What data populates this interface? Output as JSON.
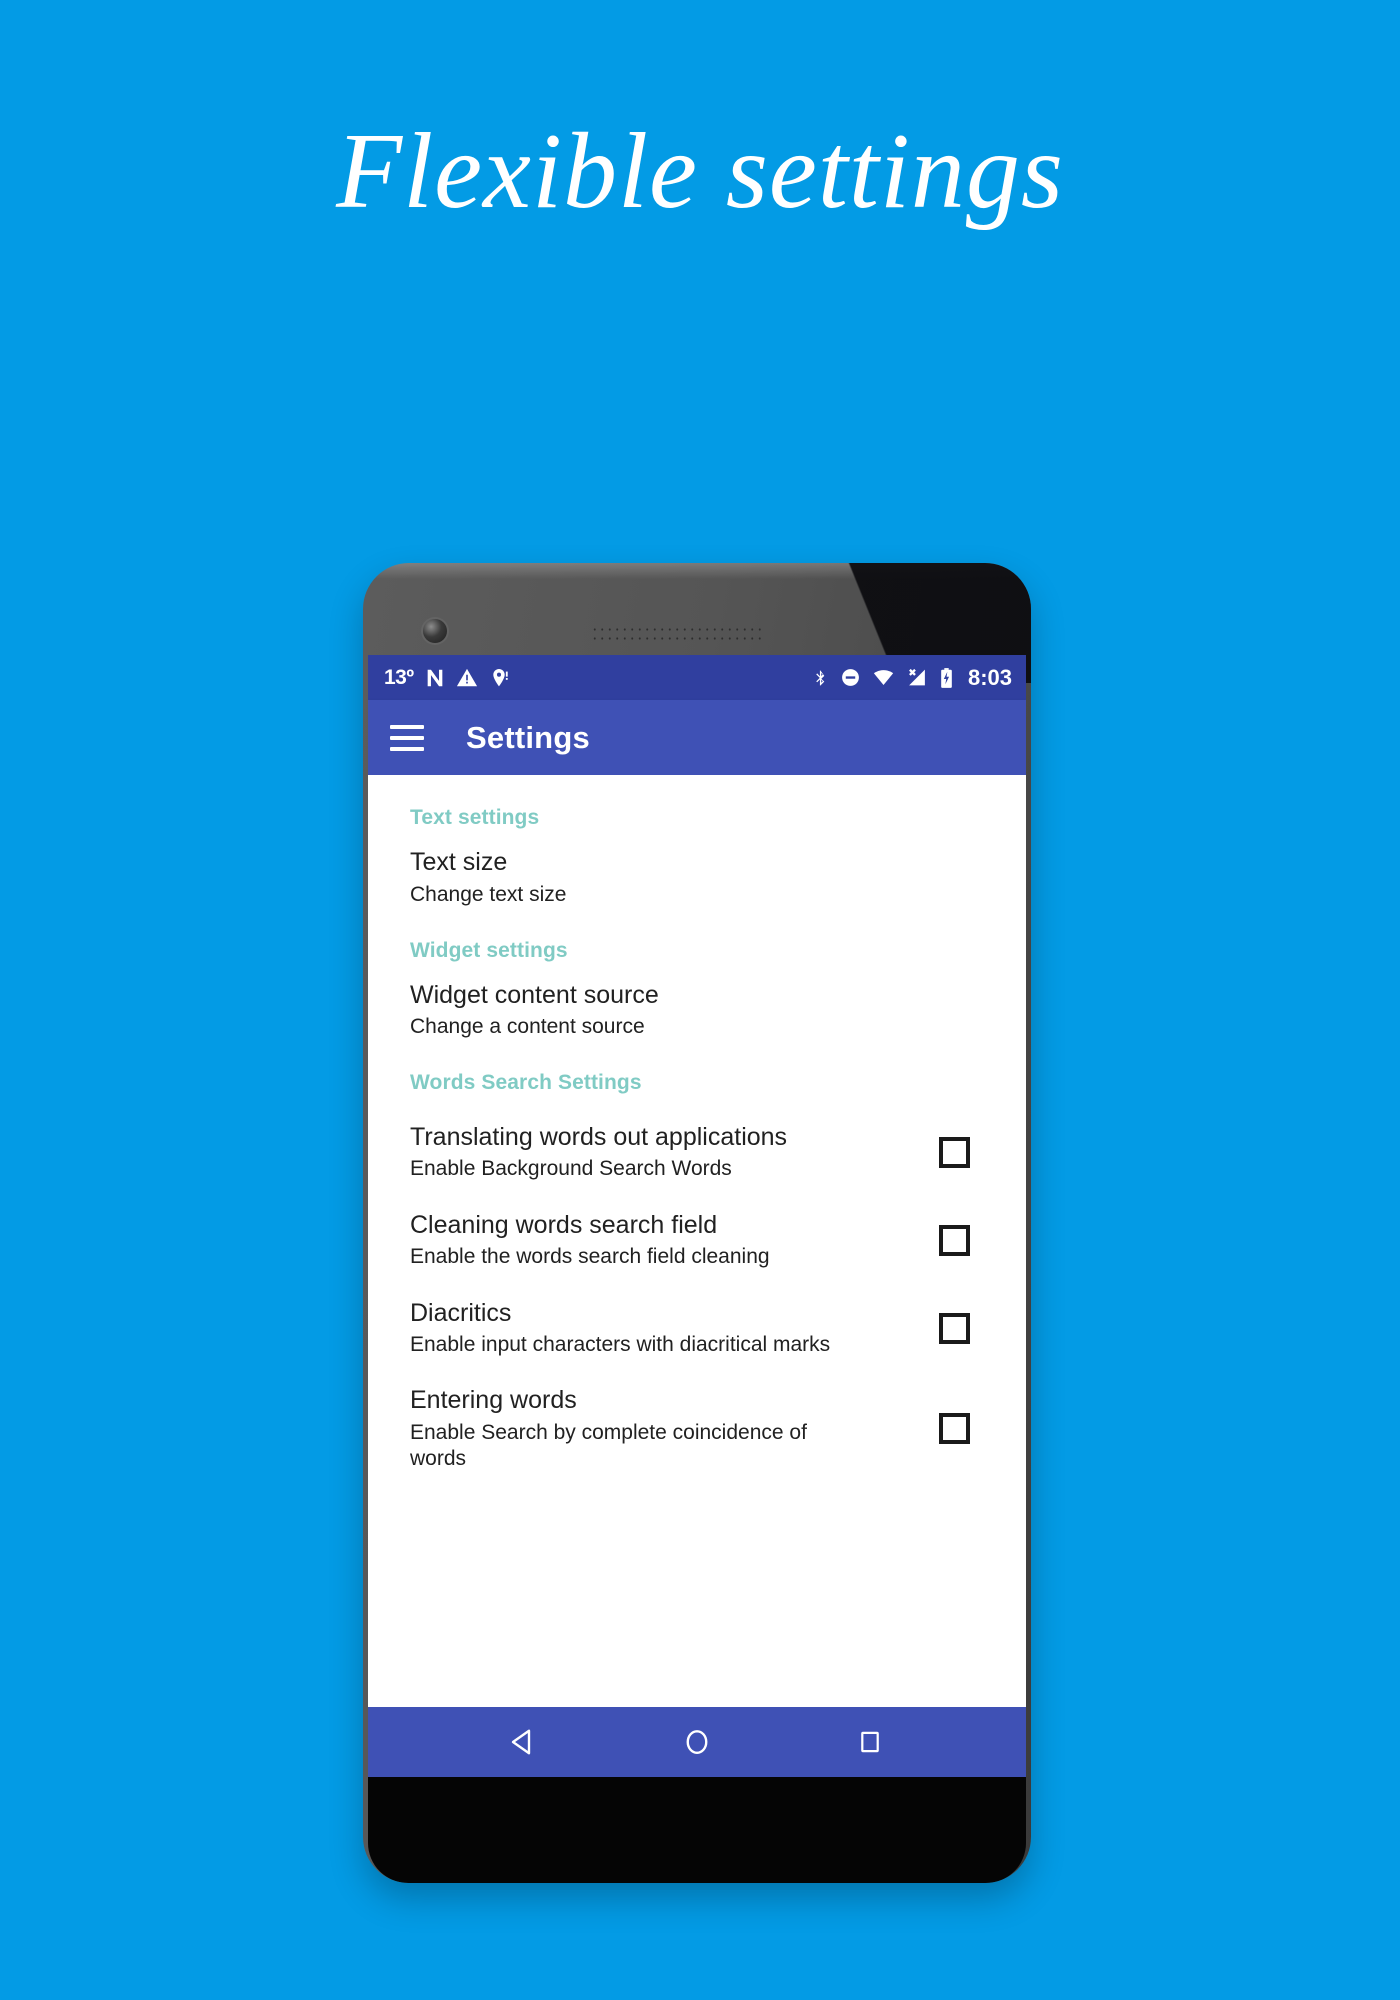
{
  "page": {
    "headline": "Flexible settings",
    "background_color": "#039BE5"
  },
  "device": {
    "camera_icon": "front-camera-icon",
    "speaker_icon": "earpiece-speaker-icon"
  },
  "statusbar": {
    "background_color": "#303F9F",
    "temperature": "13º",
    "clock": "8:03",
    "left_icons": [
      "android-n-icon",
      "warning-triangle-icon",
      "location-icon"
    ],
    "right_icons": [
      "bluetooth-icon",
      "do-not-disturb-icon",
      "wifi-icon",
      "cell-signal-off-icon",
      "battery-charging-icon"
    ]
  },
  "appbar": {
    "background_color": "#3F51B5",
    "menu_icon": "hamburger-menu-icon",
    "title": "Settings"
  },
  "settings": {
    "section_header_color": "#80CBC4",
    "sections": [
      {
        "header": "Text settings",
        "items": [
          {
            "title": "Text size",
            "summary": "Change text size",
            "has_checkbox": false
          }
        ]
      },
      {
        "header": "Widget settings",
        "items": [
          {
            "title": "Widget content source",
            "summary": "Change a content source",
            "has_checkbox": false
          }
        ]
      },
      {
        "header": "Words Search Settings",
        "items": [
          {
            "title": "Translating words out applications",
            "summary": "Enable Background Search Words",
            "has_checkbox": true,
            "checked": false
          },
          {
            "title": "Cleaning words search field",
            "summary": "Enable the words search field cleaning",
            "has_checkbox": true,
            "checked": false
          },
          {
            "title": "Diacritics",
            "summary": "Enable input characters with diacritical marks",
            "has_checkbox": true,
            "checked": false
          },
          {
            "title": "Entering words",
            "summary": "Enable Search by complete coincidence of words",
            "has_checkbox": true,
            "checked": false
          }
        ]
      }
    ]
  },
  "navbar": {
    "background_color": "#3F51B5",
    "buttons": [
      {
        "name": "back-button",
        "icon": "back-triangle-icon"
      },
      {
        "name": "home-button",
        "icon": "home-circle-icon"
      },
      {
        "name": "recents-button",
        "icon": "recents-square-icon"
      }
    ]
  }
}
